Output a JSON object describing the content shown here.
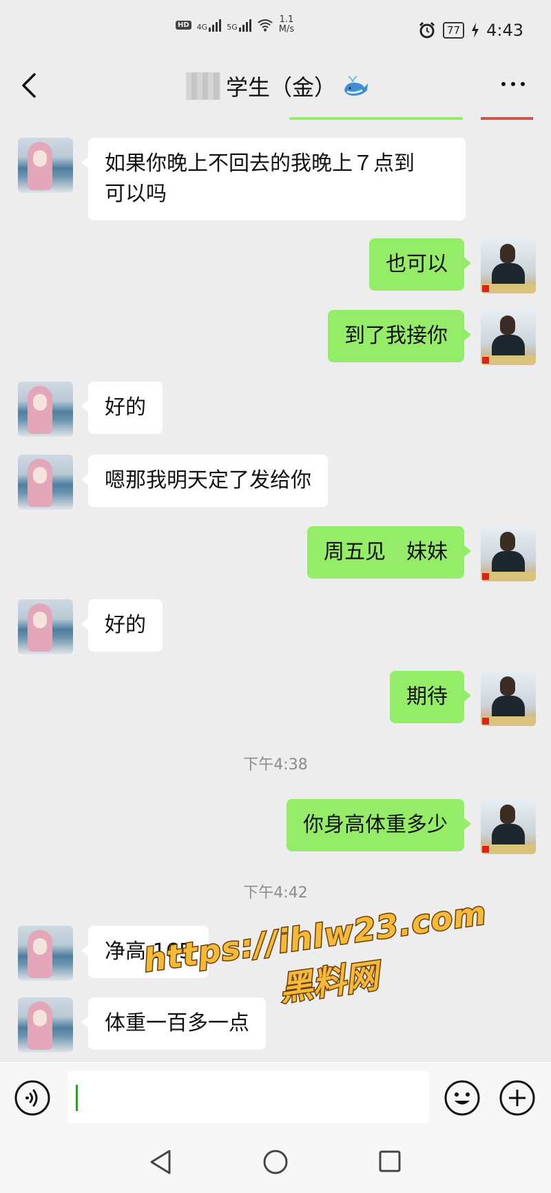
{
  "status_bar": {
    "hd_label": "HD",
    "net_4g": "4G",
    "net_5g": "5G",
    "speed_value": "1.1",
    "speed_unit": "M/s",
    "battery": "77",
    "time": "4:43"
  },
  "header": {
    "title": "学生（金）",
    "icons": {
      "back": "chevron-left-icon",
      "whale": "whale-emoji-icon",
      "more": "more-dots-icon"
    }
  },
  "messages": [
    {
      "side": "in",
      "text_lines": [
        "如果你晚上不回去的我晚上７点到",
        "可以吗"
      ]
    },
    {
      "side": "out",
      "text": "也可以"
    },
    {
      "side": "out",
      "text": "到了我接你"
    },
    {
      "side": "in",
      "text": "好的"
    },
    {
      "side": "in",
      "text": "嗯那我明天定了发给你"
    },
    {
      "side": "out",
      "text": "周五见　妹妹"
    },
    {
      "side": "in",
      "text": "好的"
    },
    {
      "side": "out",
      "text": "期待"
    },
    {
      "timestamp": "下午4:38"
    },
    {
      "side": "out",
      "text": "你身高体重多少"
    },
    {
      "timestamp": "下午4:42"
    },
    {
      "side": "in",
      "text": "净高 165"
    },
    {
      "side": "in",
      "text": "体重一百多一点"
    }
  ],
  "watermark": {
    "url": "https://ihlw23.com",
    "text": "黑料网"
  },
  "input_bar": {
    "value": "",
    "icons": {
      "voice": "voice-icon",
      "emoji": "emoji-icon",
      "plus": "plus-icon"
    }
  },
  "nav_bar": {
    "icons": {
      "back": "nav-back-icon",
      "home": "nav-home-icon",
      "recent": "nav-recent-icon"
    }
  },
  "colors": {
    "background": "#ededed",
    "outgoing_bubble": "#95ec69",
    "incoming_bubble": "#ffffff",
    "timestamp": "#8c8c8c",
    "watermark": "#f5b93a"
  }
}
